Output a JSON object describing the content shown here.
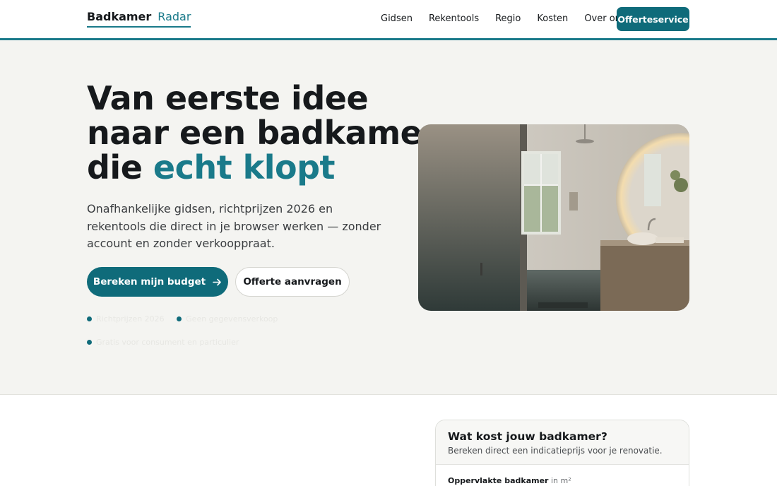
{
  "header": {
    "logo_part1": "Badkamer",
    "logo_part2": "Radar",
    "nav": [
      "Gidsen",
      "Rekentools",
      "Regio",
      "Kosten",
      "Over ons"
    ],
    "cta": "Offerteservice"
  },
  "hero": {
    "title_line1": "Van eerste idee",
    "title_line2": "naar een badkamer",
    "title_line3_plain": "die",
    "title_line3_accent": "echt klopt",
    "lead": "Onafhankelijke gidsen, richtprijzen 2026 en rekentools die direct in je browser werken — zonder account en zonder verkooppraat.",
    "primary_button": "Bereken mijn budget",
    "primary_icon": "arrow-right-icon",
    "secondary_button": "Offerte aanvragen",
    "checks": [
      "Richtprijzen 2026",
      "Geen gegevensverkoop",
      "Gratis voor consument en particulier"
    ]
  },
  "calculator": {
    "title": "Wat kost jouw badkamer?",
    "subtitle": "Bereken direct een indicatieprijs voor je renovatie.",
    "field_label": "Oppervlakte badkamer",
    "field_unit": "in m²"
  },
  "colors": {
    "accent": "#1a7a8a",
    "button": "#0f6b7a",
    "background": "#f4f4f1"
  }
}
